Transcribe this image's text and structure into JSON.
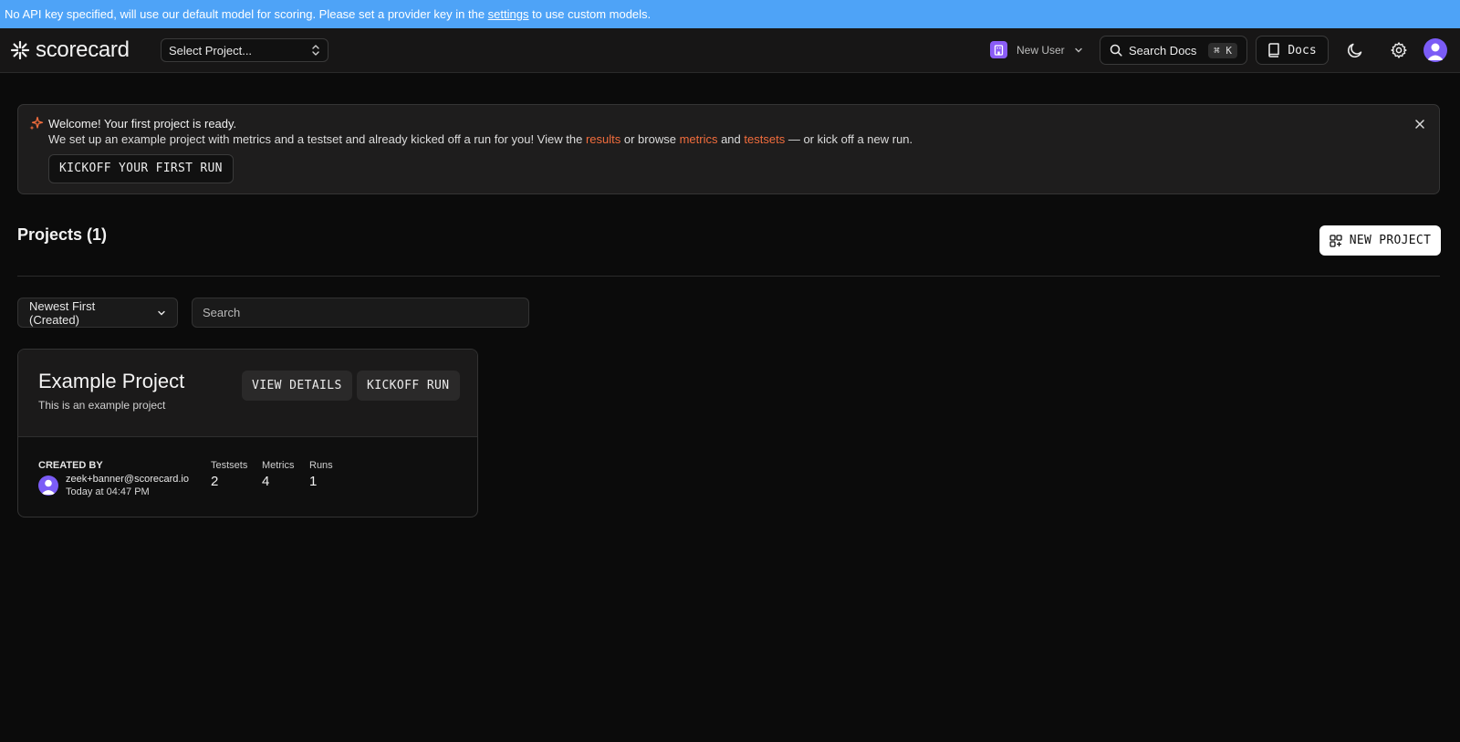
{
  "notice": {
    "text_before": "No API key specified, will use our default model for scoring. Please set a provider key in the",
    "link": "settings",
    "text_after": "to use custom models."
  },
  "header": {
    "logo_text": "scorecard",
    "project_select": "Select Project...",
    "user_name": "New User",
    "search_docs": "Search Docs",
    "search_shortcut": "⌘ K",
    "docs_label": "Docs"
  },
  "welcome": {
    "title": "Welcome! Your first project is ready.",
    "desc_1": "We set up an example project with metrics and a testset and already kicked off a run for you! View the",
    "link_results": "results",
    "desc_2": "or browse",
    "link_metrics": "metrics",
    "desc_3": "and",
    "link_testsets": "testsets",
    "desc_4": "— or kick off a new run.",
    "button": "KICKOFF YOUR FIRST RUN"
  },
  "projects": {
    "title": "Projects (1)",
    "new_button": "NEW PROJECT",
    "sort": "Newest First (Created)",
    "search_placeholder": "Search"
  },
  "card": {
    "title": "Example Project",
    "description": "This is an example project",
    "view_details": "VIEW DETAILS",
    "kickoff_run": "KICKOFF RUN",
    "created_by_label": "CREATED BY",
    "creator_email": "zeek+banner@scorecard.io",
    "created_time": "Today at 04:47 PM",
    "testsets_label": "Testsets",
    "testsets": "2",
    "metrics_label": "Metrics",
    "metrics": "4",
    "runs_label": "Runs",
    "runs": "1"
  },
  "colors": {
    "banner": "#4ea3f7",
    "accent_link": "#f26d3d",
    "avatar": "#7b5cf6"
  }
}
